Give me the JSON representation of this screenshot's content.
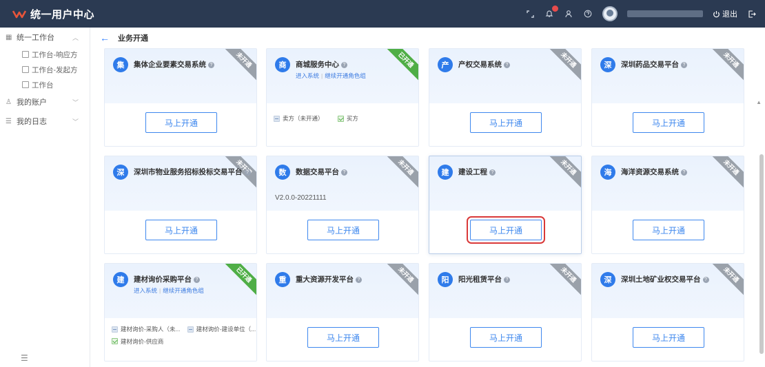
{
  "header": {
    "app_title": "统一用户中心",
    "logout_label": "退出"
  },
  "sidebar": {
    "workbench_label": "统一工作台",
    "items": [
      {
        "label": "工作台-响应方"
      },
      {
        "label": "工作台-发起方"
      },
      {
        "label": "工作台"
      }
    ],
    "account_label": "我的账户",
    "log_label": "我的日志"
  },
  "breadcrumb": {
    "title": "业务开通"
  },
  "cards": [
    {
      "icon_char": "集",
      "title": "集体企业要素交易系统",
      "ribbon": "未开通",
      "button": "马上开通"
    },
    {
      "icon_char": "商",
      "title": "商城服务中心",
      "ribbon": "已开通",
      "link1": "进入系统",
      "link2": "继续开通角色组",
      "roles": [
        {
          "label": "卖方（未开通）",
          "status": "off"
        },
        {
          "label": "买方",
          "status": "on"
        }
      ]
    },
    {
      "icon_char": "产",
      "title": "产权交易系统",
      "ribbon": "未开通",
      "button": "马上开通"
    },
    {
      "icon_char": "深",
      "title": "深圳药品交易平台",
      "ribbon": "未开通",
      "button": "马上开通"
    },
    {
      "icon_char": "深",
      "title": "深圳市物业服务招标投标交易平台",
      "ribbon": "未开通",
      "button": "马上开通"
    },
    {
      "icon_char": "数",
      "title": "数据交易平台",
      "ribbon": "未开通",
      "button": "马上开通",
      "version": "V2.0.0-20221111"
    },
    {
      "icon_char": "建",
      "title": "建设工程",
      "ribbon": "未开通",
      "button": "马上开通"
    },
    {
      "icon_char": "海",
      "title": "海洋资源交易系统",
      "ribbon": "未开通",
      "button": "马上开通"
    },
    {
      "icon_char": "建",
      "title": "建材询价采购平台",
      "ribbon": "已开通",
      "link1": "进入系统",
      "link2": "继续开通角色组",
      "roles": [
        {
          "label": "建材询价-采购人（未...",
          "status": "off"
        },
        {
          "label": "建材询价-建设单位（...",
          "status": "off"
        },
        {
          "label": "建材询价-供应商",
          "status": "on"
        }
      ]
    },
    {
      "icon_char": "重",
      "title": "重大资源开发平台",
      "ribbon": "未开通",
      "button": "马上开通"
    },
    {
      "icon_char": "阳",
      "title": "阳光租赁平台",
      "ribbon": "未开通",
      "button": "马上开通"
    },
    {
      "icon_char": "深",
      "title": "深圳土地矿业权交易平台",
      "ribbon": "未开通",
      "button": "马上开通"
    }
  ]
}
